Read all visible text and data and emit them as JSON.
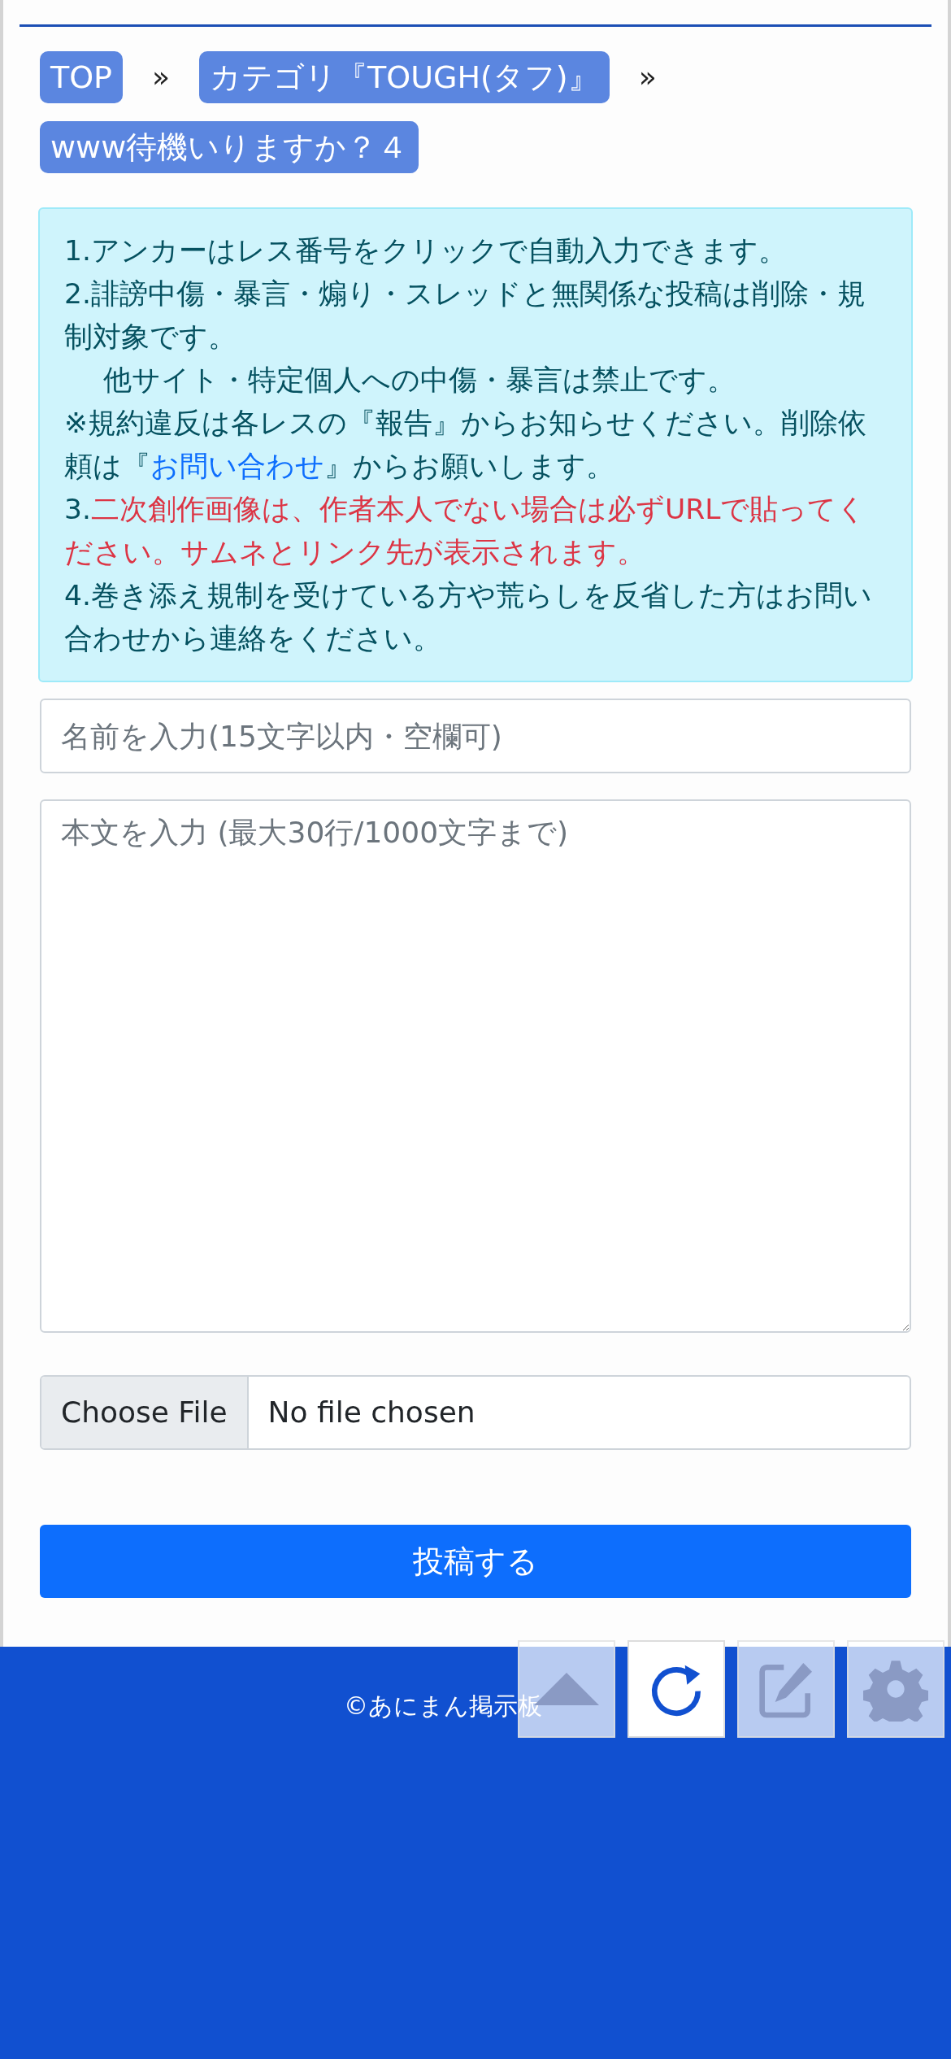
{
  "breadcrumbs": [
    {
      "label": "TOP"
    },
    {
      "label": "カテゴリ『TOUGH(タフ)』"
    },
    {
      "label": "www待機いりますか？４"
    }
  ],
  "breadcrumb_separators": [
    "»",
    "»"
  ],
  "notice": [
    {
      "kind": "plain",
      "segments": [
        {
          "kind": "text",
          "text": "1.アンカーはレス番号をクリックで自動入力できます。"
        }
      ]
    },
    {
      "kind": "plain",
      "segments": [
        {
          "kind": "text",
          "text": "2.誹謗中傷・暴言・煽り・スレッドと無関係な投稿は削除・規制対象です。"
        }
      ]
    },
    {
      "kind": "indented",
      "segments": [
        {
          "kind": "text",
          "text": "他サイト・特定個人への中傷・暴言は禁止です。"
        }
      ]
    },
    {
      "kind": "plain",
      "segments": [
        {
          "kind": "text",
          "text": "※規約違反は各レスの『報告』からお知らせください。削除依頼は『"
        },
        {
          "kind": "link",
          "text": "お問い合わせ"
        },
        {
          "kind": "text",
          "text": "』からお願いします。"
        }
      ]
    },
    {
      "kind": "plain",
      "segments": [
        {
          "kind": "text",
          "text": "3."
        },
        {
          "kind": "warning",
          "text": "二次創作画像は、作者本人でない場合は必ずURLで貼ってください。サムネとリンク先が表示されます。"
        }
      ]
    },
    {
      "kind": "plain",
      "segments": [
        {
          "kind": "text",
          "text": "4.巻き添え規制を受けている方や荒らしを反省した方はお問い合わせから連絡をください。"
        }
      ]
    }
  ],
  "name_field": {
    "placeholder": "名前を入力(15文字以内・空欄可)"
  },
  "body_field": {
    "placeholder": "本文を入力 (最大30行/1000文字まで)"
  },
  "file_input": {
    "button": "Choose File",
    "status": "No file chosen"
  },
  "submit_button": "投稿する",
  "footer": {
    "copyright": "©あにまん掲示板"
  },
  "floating_buttons": [
    {
      "kind": "up",
      "active": false
    },
    {
      "kind": "reload",
      "active": true
    },
    {
      "kind": "edit",
      "active": false
    },
    {
      "kind": "settings",
      "active": false
    }
  ]
}
